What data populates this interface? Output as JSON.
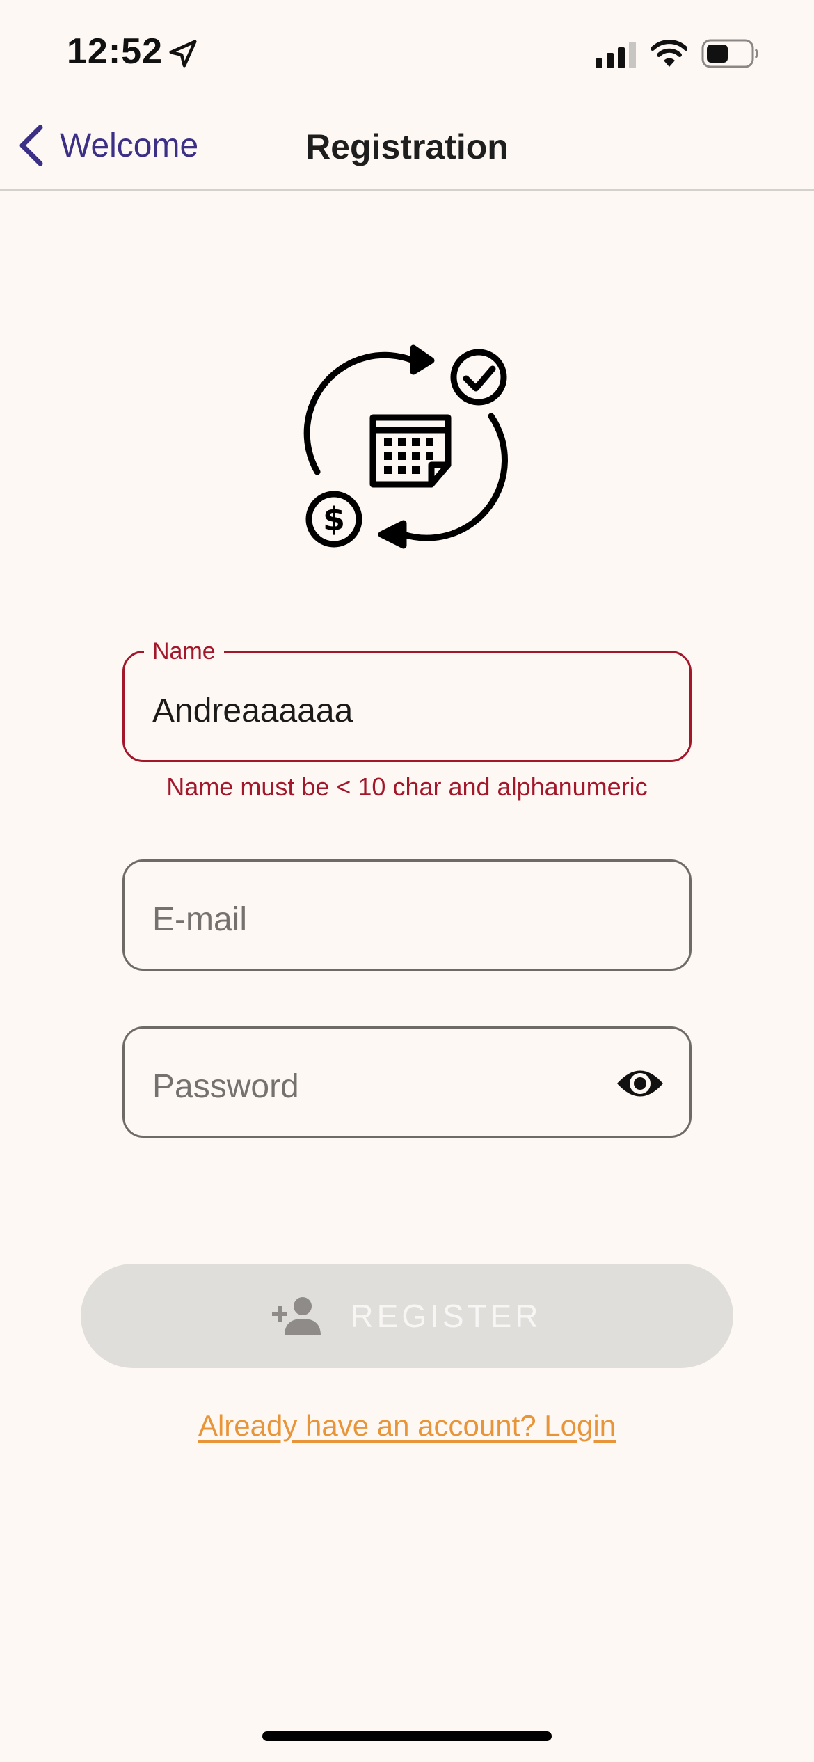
{
  "status_bar": {
    "time": "12:52",
    "icons": [
      "location-arrow-icon",
      "cellular-signal-icon",
      "wifi-icon",
      "battery-icon"
    ]
  },
  "nav": {
    "back_label": "Welcome",
    "title": "Registration"
  },
  "logo": {
    "icon": "calendar-cycle-payment-icon"
  },
  "form": {
    "name": {
      "label": "Name",
      "value": "Andreaaaaaa",
      "error": "Name must be < 10 char and alphanumeric"
    },
    "email": {
      "placeholder": "E-mail"
    },
    "password": {
      "placeholder": "Password",
      "toggle_icon": "eye-icon"
    }
  },
  "register_button": {
    "label": "REGISTER",
    "icon": "add-person-icon",
    "enabled": false
  },
  "login_link": "Already have an account? Login",
  "colors": {
    "background": "#fdf8f4",
    "accent": "#3b2f86",
    "error": "#a3172b",
    "link": "#e8953a",
    "button_disabled": "#e0deda"
  }
}
